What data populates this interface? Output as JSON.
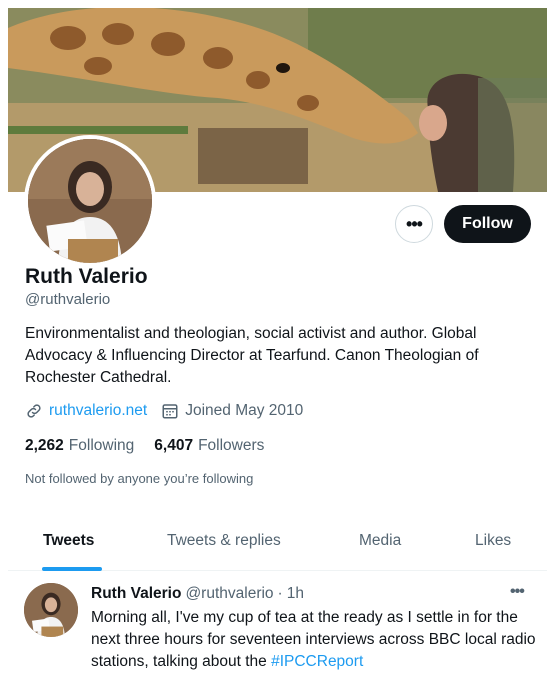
{
  "profile": {
    "name": "Ruth Valerio",
    "handle": "@ruthvalerio",
    "bio": "Environmentalist and theologian, social activist and author. Global Advocacy & Influencing Director at Tearfund. Canon Theologian of Rochester Cathedral.",
    "website": "ruthvalerio.net",
    "joined": "Joined May 2010",
    "following_count": "2,262",
    "following_label": "Following",
    "followers_count": "6,407",
    "followers_label": "Followers",
    "not_followed": "Not followed by anyone you’re following"
  },
  "actions": {
    "more_label": "•••",
    "follow_label": "Follow"
  },
  "tabs": [
    {
      "label": "Tweets",
      "active": true
    },
    {
      "label": "Tweets & replies",
      "active": false
    },
    {
      "label": "Media",
      "active": false
    },
    {
      "label": "Likes",
      "active": false
    }
  ],
  "tweet": {
    "author": "Ruth Valerio",
    "handle": "@ruthvalerio",
    "separator": "·",
    "time": "1h",
    "more_label": "•••",
    "text": "Morning all, I've my cup of tea at the ready as I settle in for the next three hours for seventeen interviews across BBC local radio stations, talking about the ",
    "hashtag": "#IPCCReport"
  },
  "icons": {
    "link": "link-icon",
    "calendar": "calendar-icon",
    "more": "more-horizontal-icon"
  },
  "colors": {
    "accent": "#1d9bf0",
    "text": "#0f1419",
    "secondary": "#536471",
    "follow_bg": "#0f1419"
  }
}
